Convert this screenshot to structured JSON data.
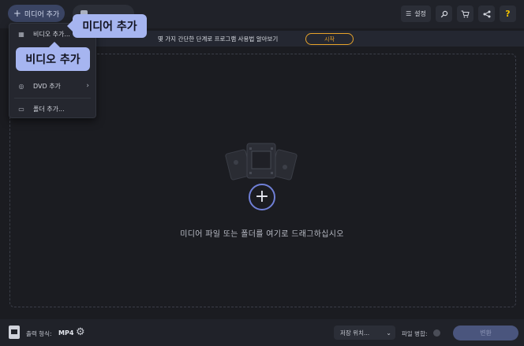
{
  "toolbar": {
    "add_media_label": "미디어 추가",
    "settings_label": "설정",
    "help_label": "?"
  },
  "promo": {
    "text": "몇 가지 간단한 단계로 프로그램 사용법 알아보기",
    "start_label": "시작"
  },
  "dropdown": {
    "items": [
      {
        "label": "비디오 추가...",
        "icon": "film-icon"
      },
      {
        "label": "DVD 추가",
        "icon": "disc-icon",
        "has_submenu": true
      },
      {
        "label": "폴더 추가...",
        "icon": "folder-icon"
      }
    ]
  },
  "tooltips": {
    "add_media": "미디어 추가",
    "add_video": "비디오 추가"
  },
  "dropzone": {
    "hint": "미디어 파일 또는 폴더를 여기로 드래그하십시오"
  },
  "bottom": {
    "output_format_label": "출력 형식:",
    "output_format_value": "MP4",
    "save_location_label": "저장 위치...",
    "merge_label": "파일 병합:",
    "convert_label": "변환"
  },
  "colors": {
    "background": "#1b1c21",
    "accent": "#6f7fd6",
    "tooltip": "#a6b5f0",
    "promo_button": "#e7a32a"
  }
}
